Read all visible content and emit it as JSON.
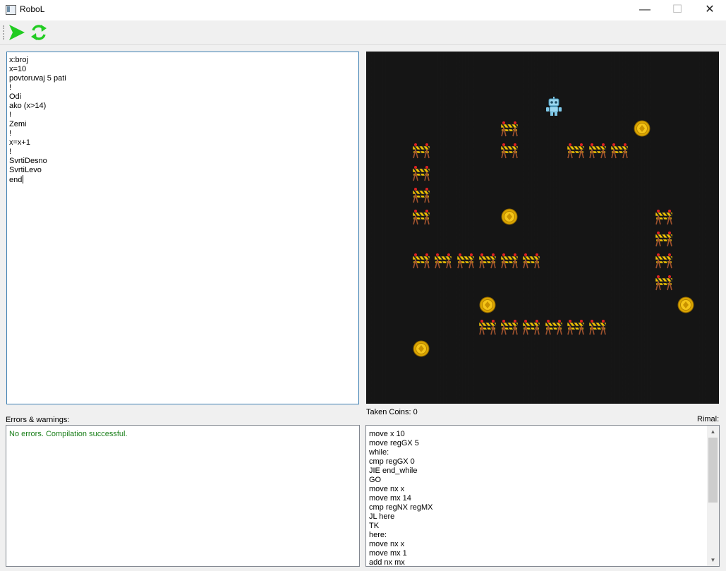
{
  "window": {
    "title": "RoboL",
    "minimize": "—",
    "maximize": "☐",
    "close": "✕"
  },
  "toolbar": {
    "run_icon": "play-arrow-icon",
    "reset_icon": "refresh-icon",
    "accent": "#22cc22"
  },
  "editor": {
    "lines": [
      "x:broj",
      "x=10",
      "povtoruvaj 5 pati",
      "!",
      "Odi",
      "ako (x>14)",
      "!",
      "Zemi",
      "!",
      "x=x+1",
      "!",
      "SvrtiDesno",
      "SvrtiLevo",
      "end"
    ]
  },
  "status": {
    "taken_coins_label": "Taken Coins: 0",
    "right_label": "Rimal:"
  },
  "errors": {
    "label": "Errors & warnings:",
    "message": "No errors. Compilation successful.",
    "message_color": "#1a7f1a"
  },
  "assembly": {
    "lines": [
      "move x 10",
      "move regGX 5",
      "while:",
      "cmp regGX 0",
      "JIE end_while",
      "GO",
      "move nx x",
      "move mx 14",
      "cmp regNX regMX",
      "JL here",
      "TK",
      "here:",
      "move nx x",
      "move mx 1",
      "add nx mx"
    ]
  },
  "board": {
    "columns": 16,
    "rows": 16,
    "robot": {
      "col": 8,
      "row": 2
    },
    "coins": [
      {
        "col": 12,
        "row": 3
      },
      {
        "col": 6,
        "row": 7
      },
      {
        "col": 5,
        "row": 11
      },
      {
        "col": 14,
        "row": 11
      },
      {
        "col": 2,
        "row": 13
      }
    ],
    "barriers": [
      {
        "col": 6,
        "row": 3
      },
      {
        "col": 6,
        "row": 4
      },
      {
        "col": 9,
        "row": 4
      },
      {
        "col": 10,
        "row": 4
      },
      {
        "col": 11,
        "row": 4
      },
      {
        "col": 2,
        "row": 4
      },
      {
        "col": 2,
        "row": 5
      },
      {
        "col": 2,
        "row": 6
      },
      {
        "col": 2,
        "row": 7
      },
      {
        "col": 13,
        "row": 7
      },
      {
        "col": 13,
        "row": 8
      },
      {
        "col": 13,
        "row": 9
      },
      {
        "col": 13,
        "row": 10
      },
      {
        "col": 2,
        "row": 9
      },
      {
        "col": 3,
        "row": 9
      },
      {
        "col": 4,
        "row": 9
      },
      {
        "col": 5,
        "row": 9
      },
      {
        "col": 6,
        "row": 9
      },
      {
        "col": 7,
        "row": 9
      },
      {
        "col": 5,
        "row": 12
      },
      {
        "col": 6,
        "row": 12
      },
      {
        "col": 7,
        "row": 12
      },
      {
        "col": 8,
        "row": 12
      },
      {
        "col": 9,
        "row": 12
      },
      {
        "col": 10,
        "row": 12
      }
    ]
  }
}
